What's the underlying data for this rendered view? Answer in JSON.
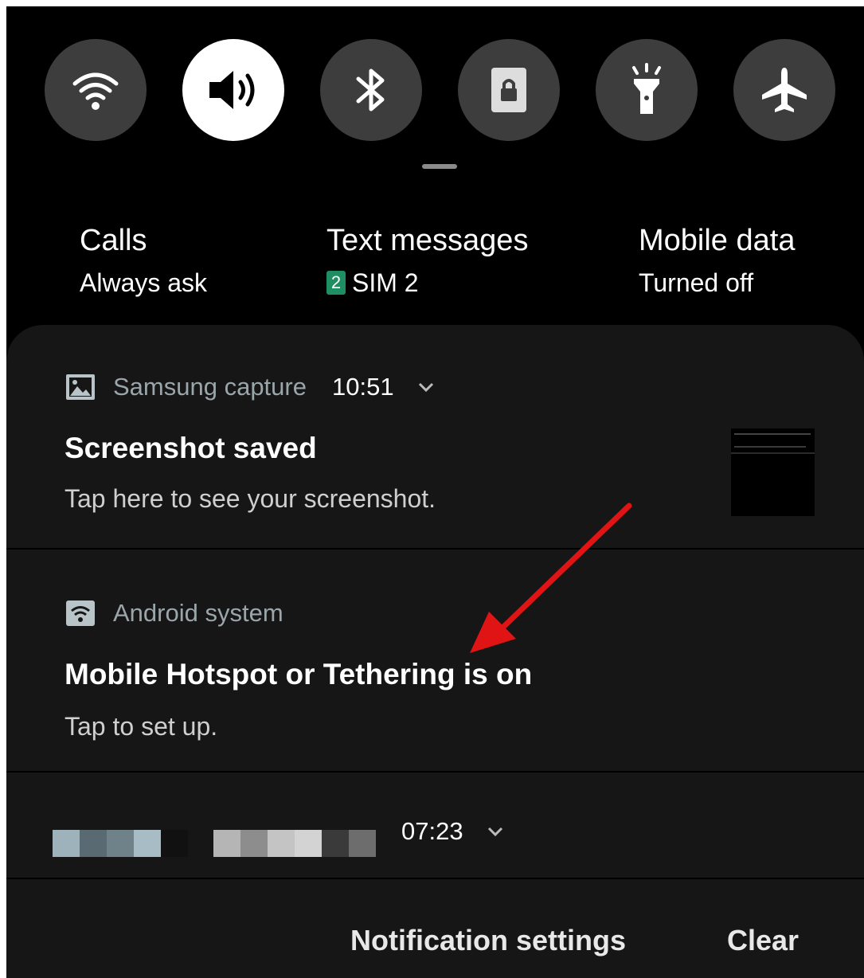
{
  "quick_settings": [
    {
      "icon": "wifi-icon",
      "active": false
    },
    {
      "icon": "sound-icon",
      "active": true
    },
    {
      "icon": "bluetooth-icon",
      "active": false
    },
    {
      "icon": "rotation-lock-icon",
      "active": false
    },
    {
      "icon": "flashlight-icon",
      "active": false
    },
    {
      "icon": "airplane-mode-icon",
      "active": false
    }
  ],
  "sim_manager": {
    "calls": {
      "title": "Calls",
      "value": "Always ask"
    },
    "text_messages": {
      "title": "Text messages",
      "badge": "2",
      "value": "SIM 2"
    },
    "mobile_data": {
      "title": "Mobile data",
      "value": "Turned off"
    }
  },
  "notifications": [
    {
      "app": "Samsung capture",
      "icon": "image-icon",
      "time": "10:51",
      "title": "Screenshot saved",
      "body": "Tap here to see your screenshot."
    },
    {
      "app": "Android system",
      "icon": "wifi-icon",
      "title": "Mobile Hotspot or Tethering is on",
      "body": "Tap to set up."
    },
    {
      "time": "07:23"
    }
  ],
  "footer": {
    "settings_label": "Notification settings",
    "clear_label": "Clear"
  },
  "colors": {
    "background": "#000000",
    "panel": "#161616",
    "active_toggle": "#ffffff",
    "inactive_toggle": "#3d3d3d",
    "sim_badge": "#1f8f63",
    "arrow": "#e01414"
  }
}
